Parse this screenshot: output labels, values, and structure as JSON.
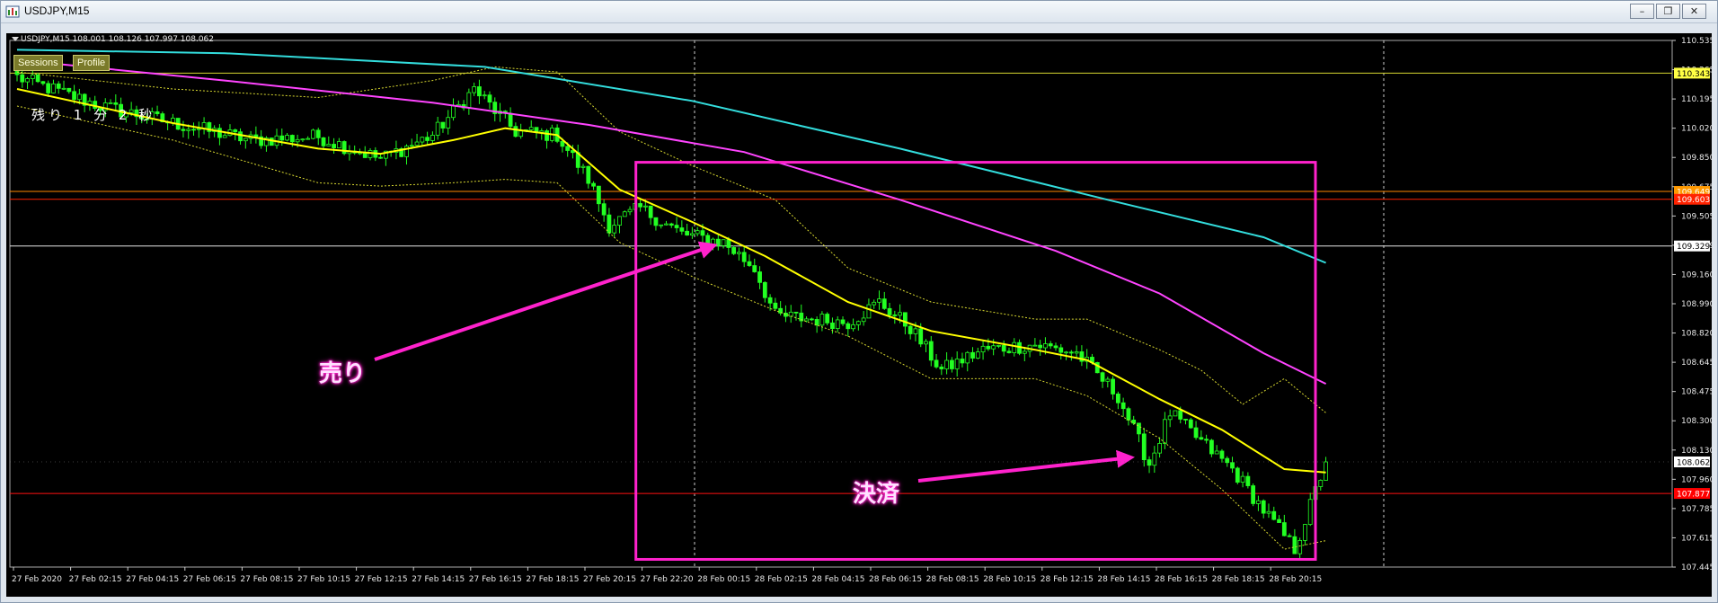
{
  "window": {
    "title": "USDJPY,M15",
    "controls": [
      "minimize-icon",
      "restore-icon",
      "close-icon"
    ]
  },
  "chart_header": {
    "symbol_info": "USDJPY,M15  108.001 108.126 107.997 108.062"
  },
  "panel_tags": [
    "Sessions",
    "Profile"
  ],
  "countdown_text": "残り 1 分 2 秒",
  "annotations": {
    "sell": "売り",
    "settle": "決済"
  },
  "colors": {
    "background": "#000000",
    "bull": "#22ff22",
    "bear": "#000000",
    "ma_fast": "#ffff00",
    "ma_mid": "#ff44ff",
    "ma_slow": "#33dddd",
    "box": "#ff22cc"
  },
  "chart_data": {
    "type": "candlestick",
    "ylim": [
      107.445,
      110.535
    ],
    "price_ticks": [
      "110.535",
      "110.365",
      "110.195",
      "110.020",
      "109.850",
      "109.675",
      "109.505",
      "109.329",
      "109.160",
      "108.990",
      "108.820",
      "108.645",
      "108.475",
      "108.300",
      "108.130",
      "107.960",
      "107.785",
      "107.615",
      "107.445"
    ],
    "price_markers": [
      {
        "value": "110.343",
        "color": "#ffff44"
      },
      {
        "value": "109.649",
        "color": "#ff9900"
      },
      {
        "value": "109.603",
        "color": "#ff2200"
      },
      {
        "value": "109.329",
        "color": "#ffffff"
      },
      {
        "value": "108.062",
        "color": "#ffffff"
      },
      {
        "value": "107.877",
        "color": "#ff0000"
      }
    ],
    "time_ticks": [
      "27 Feb 2020",
      "27 Feb 02:15",
      "27 Feb 04:15",
      "27 Feb 06:15",
      "27 Feb 08:15",
      "27 Feb 10:15",
      "27 Feb 12:15",
      "27 Feb 14:15",
      "27 Feb 16:15",
      "27 Feb 18:15",
      "27 Feb 20:15",
      "27 Feb 22:20",
      "28 Feb 00:15",
      "28 Feb 02:15",
      "28 Feb 04:15",
      "28 Feb 06:15",
      "28 Feb 08:15",
      "28 Feb 10:15",
      "28 Feb 12:15",
      "28 Feb 14:15",
      "28 Feb 16:15",
      "28 Feb 18:15",
      "28 Feb 20:15"
    ],
    "last_price": "108.062",
    "hlines": [
      {
        "value": 110.343,
        "color": "#d8d830"
      },
      {
        "value": 109.649,
        "color": "#ff8800"
      },
      {
        "value": 109.603,
        "color": "#ff2200"
      },
      {
        "value": 109.329,
        "color": "#e8e8e8"
      },
      {
        "value": 107.877,
        "color": "#ff1111"
      }
    ],
    "vlines": [
      "27 Feb 22:20",
      "28 Feb 22:00"
    ],
    "anchors": [
      {
        "t": 0,
        "p": 110.32
      },
      {
        "t": 16,
        "p": 110.15
      },
      {
        "t": 30,
        "p": 110.05
      },
      {
        "t": 45,
        "p": 109.95
      },
      {
        "t": 58,
        "p": 109.97
      },
      {
        "t": 70,
        "p": 109.84
      },
      {
        "t": 80,
        "p": 109.98
      },
      {
        "t": 88,
        "p": 110.25
      },
      {
        "t": 96,
        "p": 110.0
      },
      {
        "t": 104,
        "p": 109.98
      },
      {
        "t": 110,
        "p": 109.72
      },
      {
        "t": 114,
        "p": 109.45
      },
      {
        "t": 120,
        "p": 109.55
      },
      {
        "t": 128,
        "p": 109.4
      },
      {
        "t": 136,
        "p": 109.35
      },
      {
        "t": 142,
        "p": 109.2
      },
      {
        "t": 146,
        "p": 108.92
      },
      {
        "t": 160,
        "p": 108.88
      },
      {
        "t": 166,
        "p": 109.0
      },
      {
        "t": 172,
        "p": 108.85
      },
      {
        "t": 178,
        "p": 108.6
      },
      {
        "t": 186,
        "p": 108.72
      },
      {
        "t": 196,
        "p": 108.75
      },
      {
        "t": 204,
        "p": 108.7
      },
      {
        "t": 212,
        "p": 108.45
      },
      {
        "t": 218,
        "p": 108.05
      },
      {
        "t": 222,
        "p": 108.35
      },
      {
        "t": 228,
        "p": 108.18
      },
      {
        "t": 234,
        "p": 108.02
      },
      {
        "t": 240,
        "p": 107.78
      },
      {
        "t": 246,
        "p": 107.55
      },
      {
        "t": 252,
        "p": 108.06
      }
    ],
    "ma_fast": [
      [
        0,
        110.25
      ],
      [
        30,
        110.05
      ],
      [
        58,
        109.9
      ],
      [
        70,
        109.87
      ],
      [
        84,
        109.95
      ],
      [
        94,
        110.02
      ],
      [
        104,
        109.98
      ],
      [
        116,
        109.66
      ],
      [
        130,
        109.47
      ],
      [
        144,
        109.27
      ],
      [
        160,
        109.0
      ],
      [
        176,
        108.83
      ],
      [
        196,
        108.72
      ],
      [
        206,
        108.66
      ],
      [
        220,
        108.43
      ],
      [
        232,
        108.25
      ],
      [
        244,
        108.02
      ],
      [
        252,
        108.0
      ]
    ],
    "ma_mid": [
      [
        0,
        110.42
      ],
      [
        40,
        110.3
      ],
      [
        80,
        110.17
      ],
      [
        110,
        110.04
      ],
      [
        140,
        109.88
      ],
      [
        170,
        109.6
      ],
      [
        200,
        109.3
      ],
      [
        220,
        109.05
      ],
      [
        240,
        108.7
      ],
      [
        252,
        108.52
      ]
    ],
    "ma_slow": [
      [
        0,
        110.48
      ],
      [
        40,
        110.46
      ],
      [
        90,
        110.38
      ],
      [
        130,
        110.18
      ],
      [
        170,
        109.9
      ],
      [
        210,
        109.6
      ],
      [
        240,
        109.38
      ],
      [
        252,
        109.23
      ]
    ],
    "band_upper": [
      [
        0,
        110.35
      ],
      [
        30,
        110.25
      ],
      [
        58,
        110.2
      ],
      [
        80,
        110.3
      ],
      [
        92,
        110.38
      ],
      [
        104,
        110.35
      ],
      [
        116,
        110.0
      ],
      [
        130,
        109.8
      ],
      [
        146,
        109.6
      ],
      [
        160,
        109.2
      ],
      [
        176,
        109.0
      ],
      [
        196,
        108.9
      ],
      [
        206,
        108.9
      ],
      [
        220,
        108.72
      ],
      [
        228,
        108.6
      ],
      [
        236,
        108.4
      ],
      [
        244,
        108.55
      ],
      [
        252,
        108.35
      ]
    ],
    "band_lower": [
      [
        0,
        110.15
      ],
      [
        30,
        109.95
      ],
      [
        58,
        109.7
      ],
      [
        70,
        109.68
      ],
      [
        84,
        109.7
      ],
      [
        94,
        109.72
      ],
      [
        104,
        109.7
      ],
      [
        116,
        109.35
      ],
      [
        130,
        109.15
      ],
      [
        146,
        108.95
      ],
      [
        160,
        108.8
      ],
      [
        176,
        108.55
      ],
      [
        196,
        108.55
      ],
      [
        206,
        108.45
      ],
      [
        220,
        108.2
      ],
      [
        232,
        107.9
      ],
      [
        244,
        107.55
      ],
      [
        252,
        107.6
      ]
    ],
    "sell_box": {
      "t_start": 115,
      "t_end": 250,
      "p_top": 109.82,
      "p_bottom": 107.49
    }
  }
}
